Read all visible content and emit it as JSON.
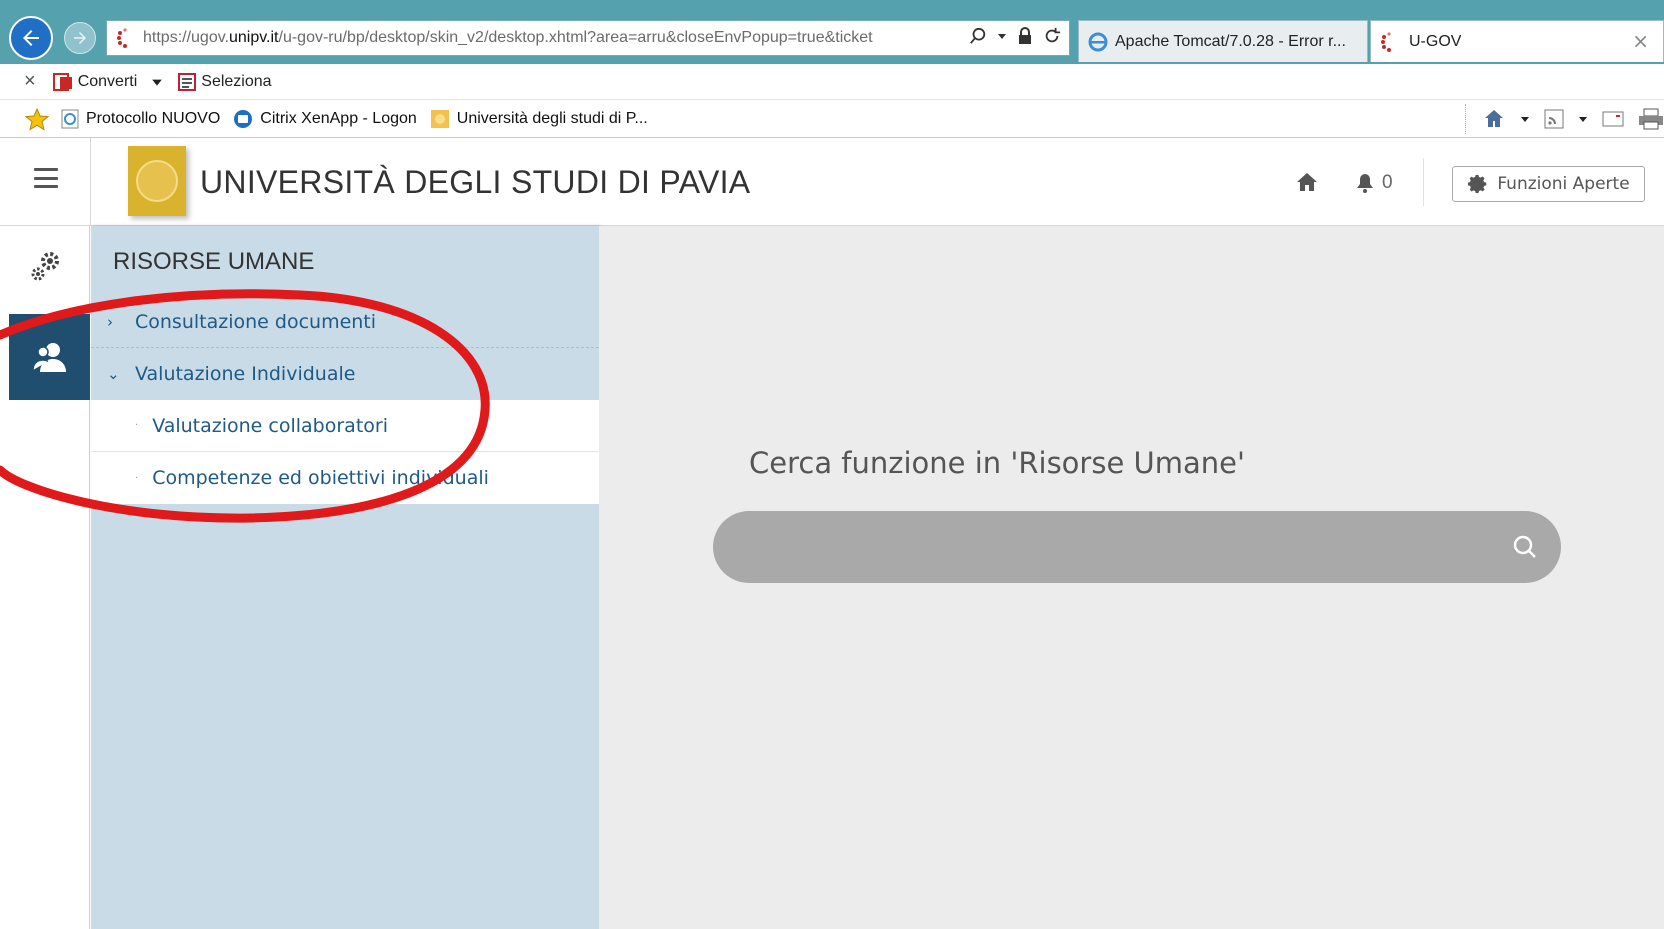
{
  "browser": {
    "address_scheme": "https://",
    "address_domain_pre": "ugov.",
    "address_domain": "unipv.it",
    "address_path": "/u-gov-ru/bp/desktop/skin_v2/desktop.xhtml?area=arru&closeEnvPopup=true&ticket",
    "tabs": [
      {
        "label": "Apache Tomcat/7.0.28 - Error r..."
      },
      {
        "label": "U-GOV"
      }
    ],
    "tab_close": "×"
  },
  "command_bar": {
    "close": "×",
    "convert_label": "Converti",
    "select_label": "Seleziona"
  },
  "favorites": {
    "items": [
      {
        "label": "Protocollo NUOVO"
      },
      {
        "label": "Citrix XenApp - Logon"
      },
      {
        "label": "Università degli studi di P..."
      }
    ]
  },
  "header": {
    "title": "UNIVERSITÀ DEGLI STUDI DI PAVIA",
    "notifications_count": "0",
    "open_functions_label": "Funzioni Aperte"
  },
  "side_menu": {
    "title": "RISORSE UMANE",
    "items": [
      {
        "label": "Consultazione documenti",
        "expanded": false
      },
      {
        "label": "Valutazione Individuale",
        "expanded": true,
        "children": [
          {
            "label": "Valutazione collaboratori"
          },
          {
            "label": "Competenze ed obiettivi individuali"
          }
        ]
      }
    ]
  },
  "main": {
    "search_heading": "Cerca funzione in 'Risorse Umane'",
    "search_value": ""
  },
  "colors": {
    "browser_frame": "#55a1ae",
    "rail_active": "#1f4e6e",
    "menu_bg": "#c8dbe7",
    "menu_text": "#1e5a86",
    "logo_gold": "#d9b22e",
    "annotation_red": "#e0191b"
  }
}
